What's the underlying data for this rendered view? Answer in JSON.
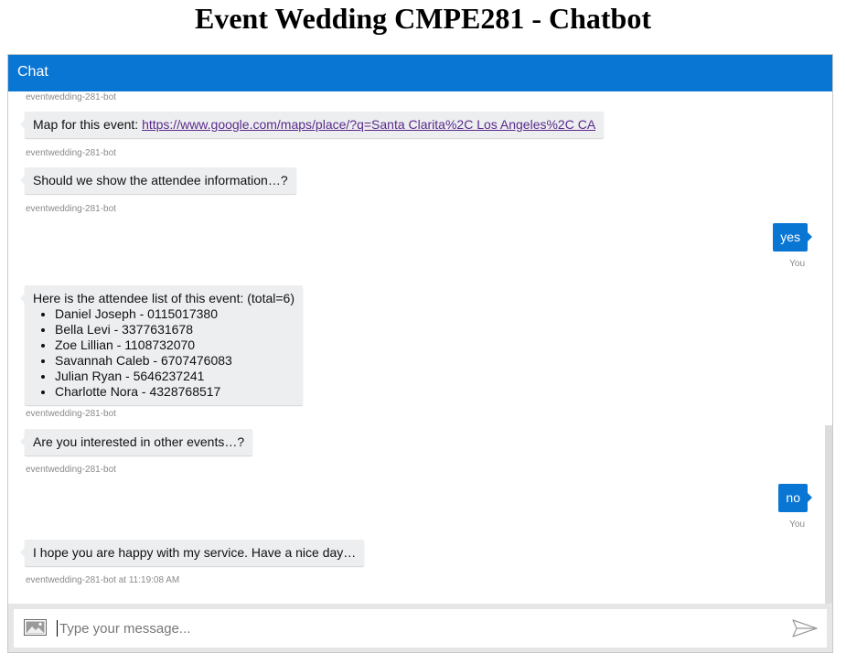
{
  "page": {
    "title": "Event Wedding CMPE281 - Chatbot"
  },
  "chat": {
    "header": "Chat",
    "messages": [
      {
        "from": "bot",
        "sender_label": "eventwedding-281-bot"
      },
      {
        "from": "bot",
        "text": "Map for this event: ",
        "link": "https://www.google.com/maps/place/?q=Santa Clarita%2C Los Angeles%2C CA",
        "sender_label": "eventwedding-281-bot"
      },
      {
        "from": "bot",
        "text": "Should we show the attendee information…?",
        "sender_label": "eventwedding-281-bot"
      },
      {
        "from": "user",
        "text": "yes",
        "sender_label": "You"
      },
      {
        "from": "bot",
        "text": "Here is the attendee list of this event: (total=6)",
        "list": [
          "Daniel Joseph - 0115017380",
          "Bella Levi - 3377631678",
          "Zoe Lillian - 1108732070",
          "Savannah Caleb - 6707476083",
          "Julian Ryan - 5646237241",
          "Charlotte Nora - 4328768517"
        ],
        "sender_label": "eventwedding-281-bot"
      },
      {
        "from": "bot",
        "text": "Are you interested in other events…?",
        "sender_label": "eventwedding-281-bot"
      },
      {
        "from": "user",
        "text": "no",
        "sender_label": "You"
      },
      {
        "from": "bot",
        "text": "I hope you are happy with my service. Have a nice day…",
        "sender_label": "eventwedding-281-bot at 11:19:08 AM"
      }
    ],
    "input": {
      "placeholder": "Type your message...",
      "value": ""
    },
    "icons": {
      "attach": "image-icon",
      "send": "send-icon"
    },
    "colors": {
      "accent": "#0a76d4",
      "bot_bubble": "#eceef0",
      "link": "#5b2b8b"
    }
  }
}
